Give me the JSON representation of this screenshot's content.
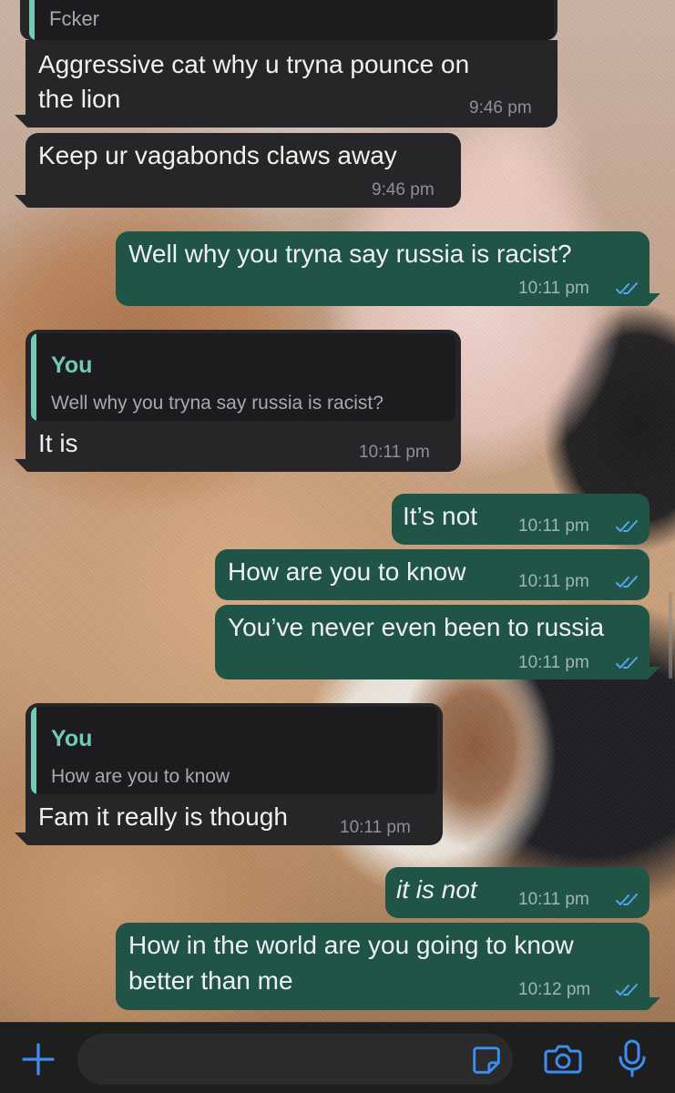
{
  "colors": {
    "incoming_bubble": "#262628",
    "outgoing_bubble": "#1f5446",
    "quote_accent": "#72c9b7",
    "read_tick": "#53a6f0",
    "icon_blue": "#3d8ef0"
  },
  "messages": [
    {
      "dir": "in",
      "quote": {
        "name": "",
        "text": "Fcker"
      },
      "text": "",
      "time": ""
    },
    {
      "dir": "in",
      "text": "Aggressive cat why u tryna pounce on",
      "text2": "the lion",
      "time": "9:46 pm"
    },
    {
      "dir": "in",
      "text": "Keep ur vagabonds claws away",
      "time": "9:46 pm"
    },
    {
      "dir": "out",
      "text": "Well why you tryna say russia is racist?",
      "time": "10:11 pm",
      "status": "read"
    },
    {
      "dir": "in",
      "quote": {
        "name": "You",
        "text": "Well why you tryna say russia is racist?"
      },
      "text": "It is",
      "time": "10:11 pm"
    },
    {
      "dir": "out",
      "text": "It’s not",
      "time": "10:11 pm",
      "status": "read"
    },
    {
      "dir": "out",
      "text": "How are you to know",
      "time": "10:11 pm",
      "status": "read"
    },
    {
      "dir": "out",
      "text": "You’ve never even been to russia",
      "time": "10:11 pm",
      "status": "read"
    },
    {
      "dir": "in",
      "quote": {
        "name": "You",
        "text": "How are you to know"
      },
      "text": "Fam it really is though",
      "time": "10:11 pm"
    },
    {
      "dir": "out",
      "text": "it is not",
      "style": "italic",
      "time": "10:11 pm",
      "status": "read"
    },
    {
      "dir": "out",
      "text": "How in the world are you going to know",
      "text2": "better than me",
      "time": "10:12 pm",
      "status": "read"
    }
  ],
  "input_bar": {
    "icons": [
      "plus-icon",
      "sticker-icon",
      "camera-icon",
      "microphone-icon"
    ],
    "message_value": ""
  }
}
